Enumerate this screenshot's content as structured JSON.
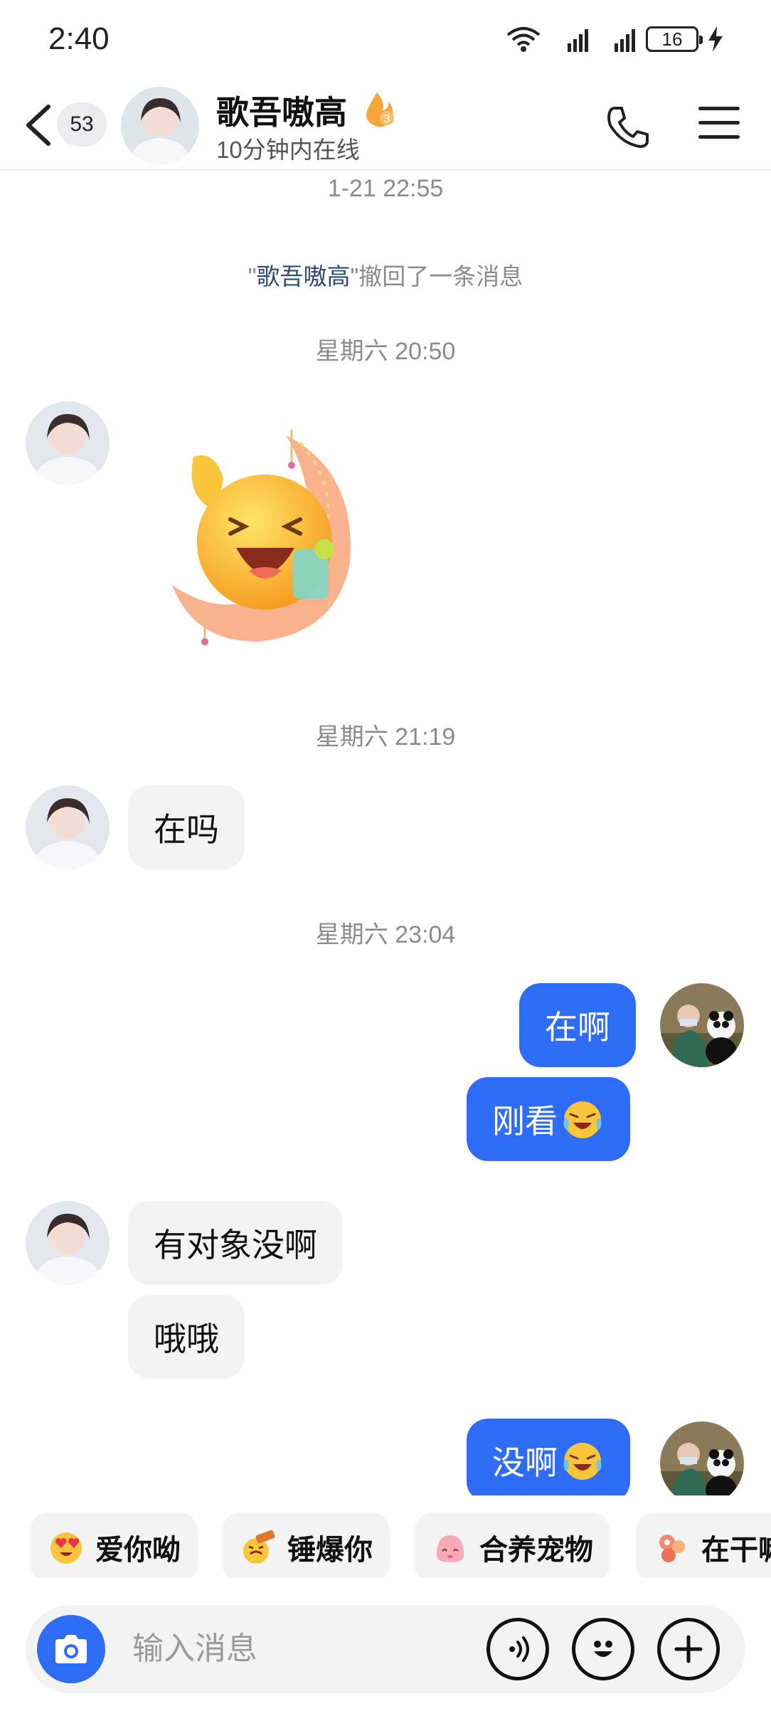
{
  "status_bar": {
    "time": "2:40",
    "battery": "16",
    "network_1": "4G",
    "network_2": "4G",
    "wifi_label": "6"
  },
  "header": {
    "unread_count": "53",
    "contact_name": "歌吾嗷高",
    "fire_level": "3",
    "online_status": "10分钟内在线"
  },
  "messages": [
    {
      "type": "timestamp",
      "text": "1-21 22:55"
    },
    {
      "type": "system",
      "prefix": "\"",
      "name": "歌吾嗷高",
      "suffix": "\"撤回了一条消息"
    },
    {
      "type": "timestamp",
      "text": "星期六 20:50"
    },
    {
      "type": "sticker",
      "from": "contact",
      "icon": "waving-moon-sticker"
    },
    {
      "type": "timestamp",
      "text": "星期六 21:19"
    },
    {
      "type": "text",
      "from": "contact",
      "text": "在吗"
    },
    {
      "type": "timestamp",
      "text": "星期六 23:04"
    },
    {
      "type": "text",
      "from": "me",
      "text": "在啊"
    },
    {
      "type": "text",
      "from": "me",
      "text": "刚看",
      "emoji": "crying-laughing-icon"
    },
    {
      "type": "text",
      "from": "contact",
      "text": "有对象没啊"
    },
    {
      "type": "text",
      "from": "contact",
      "text": "哦哦"
    },
    {
      "type": "text",
      "from": "me",
      "text": "没啊",
      "emoji": "crying-laughing-icon"
    }
  ],
  "quick_chips": [
    {
      "label": "爱你呦",
      "icon": "heart-eyes-icon"
    },
    {
      "label": "锤爆你",
      "icon": "hammer-face-icon"
    },
    {
      "label": "合养宠物",
      "icon": "pet-egg-icon"
    },
    {
      "label": "在干嘛",
      "icon": "flower-icon"
    }
  ],
  "input": {
    "placeholder": "输入消息"
  },
  "colors": {
    "accent": "#2f6cf6",
    "bubble_in": "#f3f3f4",
    "timestamp": "#8b8b8b"
  }
}
